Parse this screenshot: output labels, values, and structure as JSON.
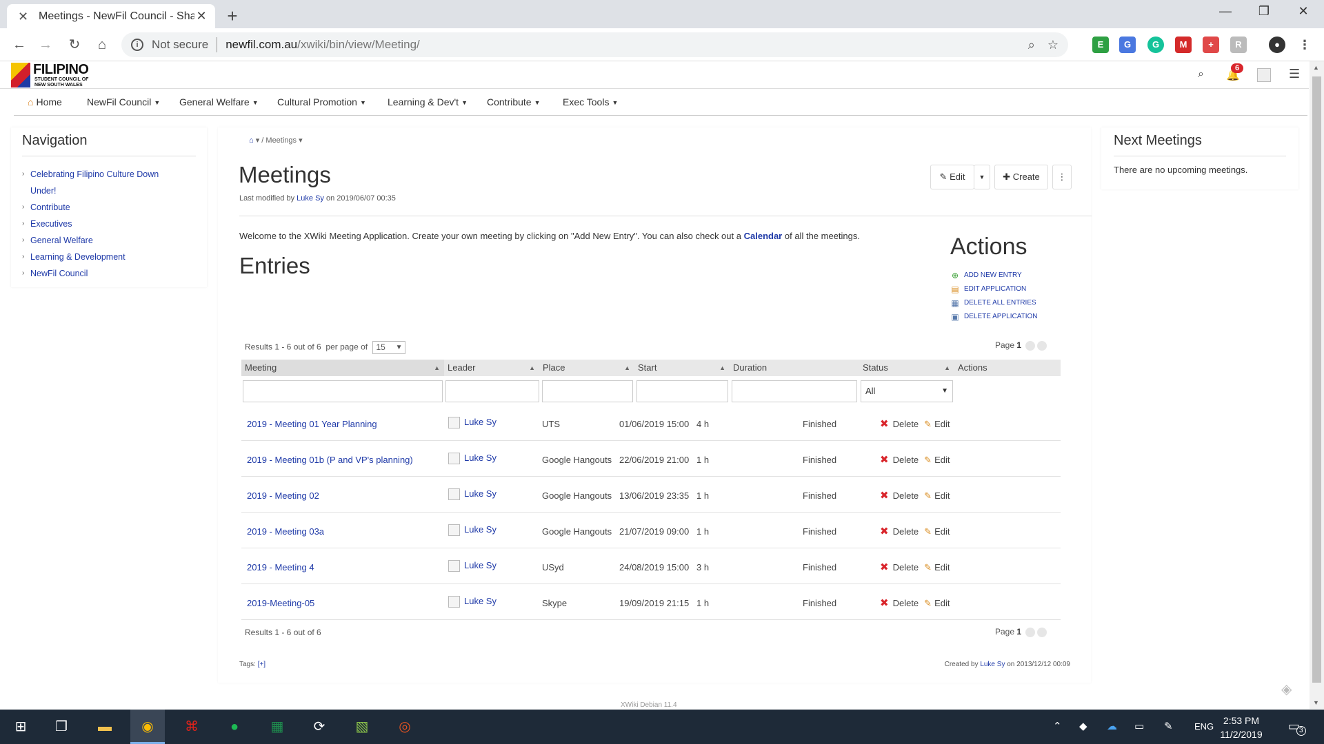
{
  "browser": {
    "tab_title": "Meetings - NewFil Council - Shar",
    "new_tab": "+",
    "url_status": "Not secure",
    "url_domain": "newfil.com.au",
    "url_path": "/xwiki/bin/view/Meeting/",
    "window_controls": [
      "—",
      "❐",
      "✕"
    ]
  },
  "logo": {
    "big": "FILIPINO",
    "line1": "STUDENT COUNCIL OF",
    "line2": "NEW SOUTH WALES"
  },
  "notifications_count": "6",
  "mainnav": [
    {
      "label": "Home"
    },
    {
      "label": "NewFil Council"
    },
    {
      "label": "General Welfare"
    },
    {
      "label": "Cultural Promotion"
    },
    {
      "label": "Learning & Dev't"
    },
    {
      "label": "Contribute"
    },
    {
      "label": "Exec Tools"
    }
  ],
  "left_panel": {
    "title": "Navigation",
    "items": [
      "Celebrating Filipino Culture Down",
      "Under!",
      "Contribute",
      "Executives",
      "General Welfare",
      "Learning & Development",
      "NewFil Council"
    ]
  },
  "right_panel": {
    "title": "Next Meetings",
    "message": "There are no upcoming meetings."
  },
  "breadcrumb": {
    "current": "Meetings"
  },
  "page": {
    "title": "Meetings",
    "last_modified_prefix": "Last modified by",
    "last_modified_user": "Luke Sy",
    "last_modified_date": "on 2019/06/07 00:35",
    "edit_label": "Edit",
    "create_label": "Create",
    "welcome_text": "Welcome to the XWiki Meeting Application. Create your own meeting by clicking on \"Add New Entry\". You can also check out a",
    "calendar_link": "Calendar",
    "welcome_suffix": "of all the meetings.",
    "entries_title": "Entries"
  },
  "actions": {
    "title": "Actions",
    "items": [
      "ADD NEW ENTRY",
      "EDIT APPLICATION",
      "DELETE ALL ENTRIES",
      "DELETE APPLICATION"
    ]
  },
  "table": {
    "results_text": "Results 1 - 6 out of 6",
    "per_page_label": "per page of",
    "per_page_value": "15",
    "page_label": "Page",
    "page_number": "1",
    "columns": [
      "Meeting",
      "Leader",
      "Place",
      "Start",
      "Duration",
      "Status",
      "Actions"
    ],
    "status_filter": "All",
    "delete_label": "Delete",
    "edit_label": "Edit",
    "rows": [
      {
        "meeting": "2019 - Meeting 01 Year Planning",
        "leader": "Luke Sy",
        "place": "UTS",
        "start": "01/06/2019 15:00",
        "duration": "4 h",
        "status": "Finished"
      },
      {
        "meeting": "2019 - Meeting 01b (P and VP's planning)",
        "leader": "Luke Sy",
        "place": "Google Hangouts",
        "start": "22/06/2019 21:00",
        "duration": "1 h",
        "status": "Finished"
      },
      {
        "meeting": "2019 - Meeting 02",
        "leader": "Luke Sy",
        "place": "Google Hangouts",
        "start": "13/06/2019 23:35",
        "duration": "1 h",
        "status": "Finished"
      },
      {
        "meeting": "2019 - Meeting 03a",
        "leader": "Luke Sy",
        "place": "Google Hangouts",
        "start": "21/07/2019 09:00",
        "duration": "1 h",
        "status": "Finished"
      },
      {
        "meeting": "2019 - Meeting 4",
        "leader": "Luke Sy",
        "place": "USyd",
        "start": "24/08/2019 15:00",
        "duration": "3 h",
        "status": "Finished"
      },
      {
        "meeting": "2019-Meeting-05",
        "leader": "Luke Sy",
        "place": "Skype",
        "start": "19/09/2019 21:15",
        "duration": "1 h",
        "status": "Finished"
      }
    ]
  },
  "footer": {
    "tags_label": "Tags:",
    "tags_add": "[+]",
    "created_prefix": "Created by",
    "created_user": "Luke Sy",
    "created_date": "on 2013/12/12 00:09",
    "version": "XWiki Debian 11.4"
  },
  "taskbar": {
    "lang": "ENG",
    "time": "2:53 PM",
    "date": "11/2/2019",
    "notif_count": "3"
  },
  "colors": {
    "link": "#1f3aa8",
    "delete": "#d9262c",
    "badge": "#d9262c"
  }
}
